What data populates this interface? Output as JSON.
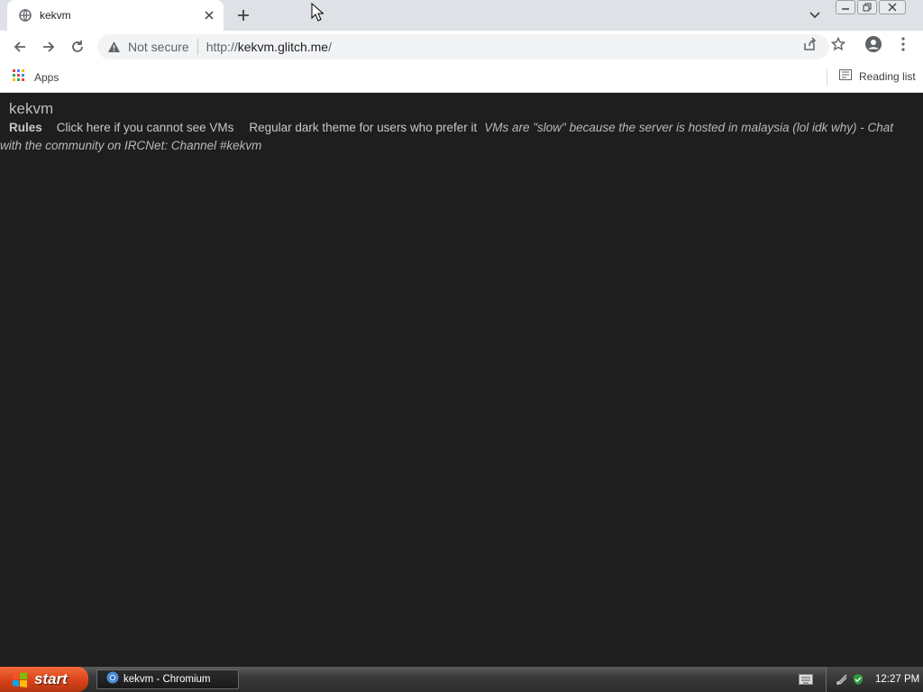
{
  "browser": {
    "tab": {
      "title": "kekvm",
      "favicon": "globe-icon"
    },
    "address": {
      "security_label": "Not secure",
      "url_prefix": "http://",
      "url_host": "kekvm.glitch.me",
      "url_suffix": "/"
    },
    "bookmarks": {
      "apps_label": "Apps",
      "reading_list_label": "Reading list"
    }
  },
  "page": {
    "title": "kekvm",
    "nav": {
      "rules": "Rules",
      "cannot_see": "Click here if you cannot see VMs",
      "dark_theme": "Regular dark theme for users who prefer it"
    },
    "notice": "VMs are \"slow\" because the server is hosted in malaysia (lol idk why) - Chat with the community on IRCNet: Channel #kekvm"
  },
  "taskbar": {
    "start_label": "start",
    "task_label": "kekvm - Chromium",
    "clock": "12:27 PM"
  },
  "colors": {
    "page_bg": "#1e1e1e",
    "start_orange": "#d8431a",
    "tabstrip": "#dee1e6"
  }
}
